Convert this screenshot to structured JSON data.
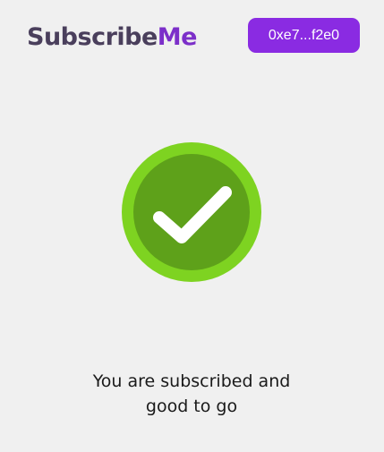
{
  "header": {
    "logo_part_a": "Subscribe",
    "logo_part_b": "Me",
    "wallet_address": "0xe7...f2e0"
  },
  "status": {
    "icon": "check-circle-icon",
    "line1": "You are subscribed and",
    "line2": "good to go"
  },
  "colors": {
    "background": "#f0f0f0",
    "brand_dark": "#4a3f5c",
    "brand_accent": "#7c2fc9",
    "button": "#8a2be2",
    "success_outer": "#7ed321",
    "success_inner": "#5ea11a"
  }
}
